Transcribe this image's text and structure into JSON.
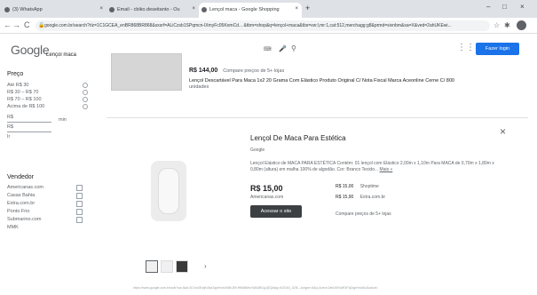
{
  "browser": {
    "tabs": [
      {
        "label": "(3) WhatsApp"
      },
      {
        "label": "Email - cbiko.deseitanto - Ou"
      },
      {
        "label": "Lençol maca - Google Shopping"
      }
    ],
    "new_tab": "+",
    "window_controls": [
      "–",
      "□",
      "×"
    ],
    "url": "google.com.br/search?rlz=1C1GCEA_enBR868BR868&sxsrf=ALiCzsb1SPqmcn-lXmyFc05KomCd... &tbm=shop&q=lençol+maca&tbs=vw:l,mr:1,cat:512,merchagg:g8&prmd=sivnbm&sa=X&ved=2ahUKEwi...",
    "back": "←",
    "forward": "→",
    "reload": "C"
  },
  "header": {
    "logo": "Google",
    "query": "Lençol maca",
    "apps_icon": "⋮⋮",
    "login_label": "Fazer login"
  },
  "sidebar": {
    "price_title": "Preço",
    "price_options": [
      "Até R$ 30",
      "R$ 30 – R$ 70",
      "R$ 70 – R$ 100",
      "Acima de R$ 100"
    ],
    "min_placeholder": "R$",
    "max_placeholder": "R$",
    "range_label": "min",
    "go_label": "Ir",
    "seller_title": "Vendedor",
    "sellers": [
      "Americanas.com",
      "Casas Bahia",
      "Extra.com.br",
      "Ponto Frio",
      "Submarino.com",
      "MMK"
    ]
  },
  "result_top": {
    "price": "R$ 144,00",
    "compare_text": "Compare preços de 5+ lojas",
    "title": "Lençol Descartável Para Maca 1x2 20 Grama Com Elástico Produto Original C/ Nota Fiscal Marca Aceonline Cerne C/ 800",
    "desc": "unidades"
  },
  "panel": {
    "title": "Lençol De Maca Para Estética",
    "store": "Google",
    "description": "Lençol Elástico de MACA PARA ESTÉTICA Contém: 01 lençol com Elástico 2,00m x 1,10m Para MACA de 0,70m x 1,80m x 0,80m (altura) em malha 100% de algodão. Cor: Branco Tecido...",
    "more": "Mais »",
    "price": "R$ 15,00",
    "seller": "Americanas.com",
    "visit_label": "Acessar o site",
    "shipping": [
      {
        "price": "R$ 15,00",
        "label": "Shoptime"
      },
      {
        "price": "R$ 15,90",
        "label": "Extra.com.br"
      }
    ],
    "compare_all": "Compare preços de 5+ lojas",
    "close_icon": "×",
    "next_icon": "›"
  },
  "footer_url": "https://www.google.com.br/aclk?sa=l&ai=DChcSEwjKx8yOqpHmAhXBhJEKHf6dBMwYABABGgJjZQ&sig=AOD64_3Zt5...&ctype=5&q=&ved=2ahUKEwiR3PqOqpHmAhU&adurl="
}
